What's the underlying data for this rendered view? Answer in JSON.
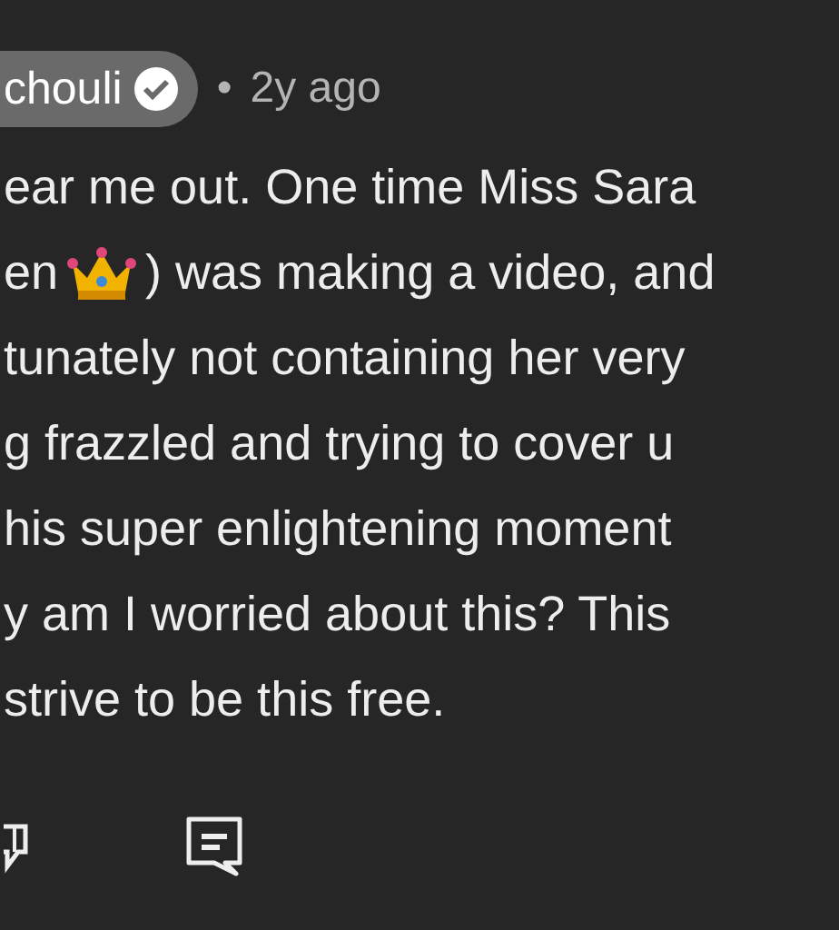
{
  "comment": {
    "author": "chouli",
    "verified": true,
    "separator": "•",
    "age": "2y ago",
    "lines": [
      {
        "text": "ear me out. One time Miss Sara"
      },
      {
        "parts": [
          {
            "kind": "text",
            "text": "en"
          },
          {
            "kind": "crown"
          },
          {
            "kind": "text",
            "text": ") was making a video, and"
          }
        ]
      },
      {
        "text": "tunately not containing her very"
      },
      {
        "text": "g frazzled and trying to cover u"
      },
      {
        "text": "his super enlightening moment"
      },
      {
        "text": "y am I worried about this? This"
      },
      {
        "text": "strive to be this free."
      }
    ],
    "actions": [
      {
        "kind": "vote"
      },
      {
        "kind": "reply"
      }
    ]
  }
}
